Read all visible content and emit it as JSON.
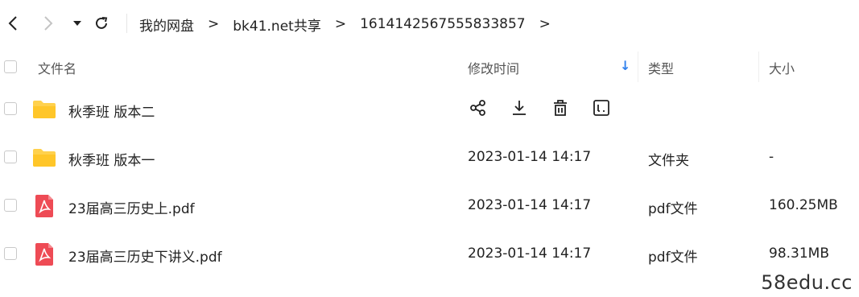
{
  "breadcrumb": {
    "items": [
      "我的网盘",
      "bk41.net共享",
      "1614142567555833857"
    ],
    "separator": ">"
  },
  "columns": {
    "name": "文件名",
    "modified": "修改时间",
    "type": "类型",
    "size": "大小",
    "sort_arrow": "↓"
  },
  "files": [
    {
      "name": "秋季班 版本二",
      "modified": "",
      "type": "",
      "size": "",
      "icon": "folder-icon"
    },
    {
      "name": "秋季班 版本一",
      "modified": "2023-01-14 14:17",
      "type": "文件夹",
      "size": "-",
      "icon": "folder-icon"
    },
    {
      "name": "23届高三历史上.pdf",
      "modified": "2023-01-14 14:17",
      "type": "pdf文件",
      "size": "160.25MB",
      "icon": "pdf-icon"
    },
    {
      "name": "23届高三历史下讲义.pdf",
      "modified": "2023-01-14 14:17",
      "type": "pdf文件",
      "size": "98.31MB",
      "icon": "pdf-icon"
    }
  ],
  "row_actions": [
    "share-icon",
    "download-icon",
    "delete-icon",
    "rename-icon"
  ],
  "watermark": "58edu.cc",
  "colors": {
    "folder": "#FFD14D",
    "pdf": "#EE4B55",
    "accent": "#2F80ED"
  }
}
